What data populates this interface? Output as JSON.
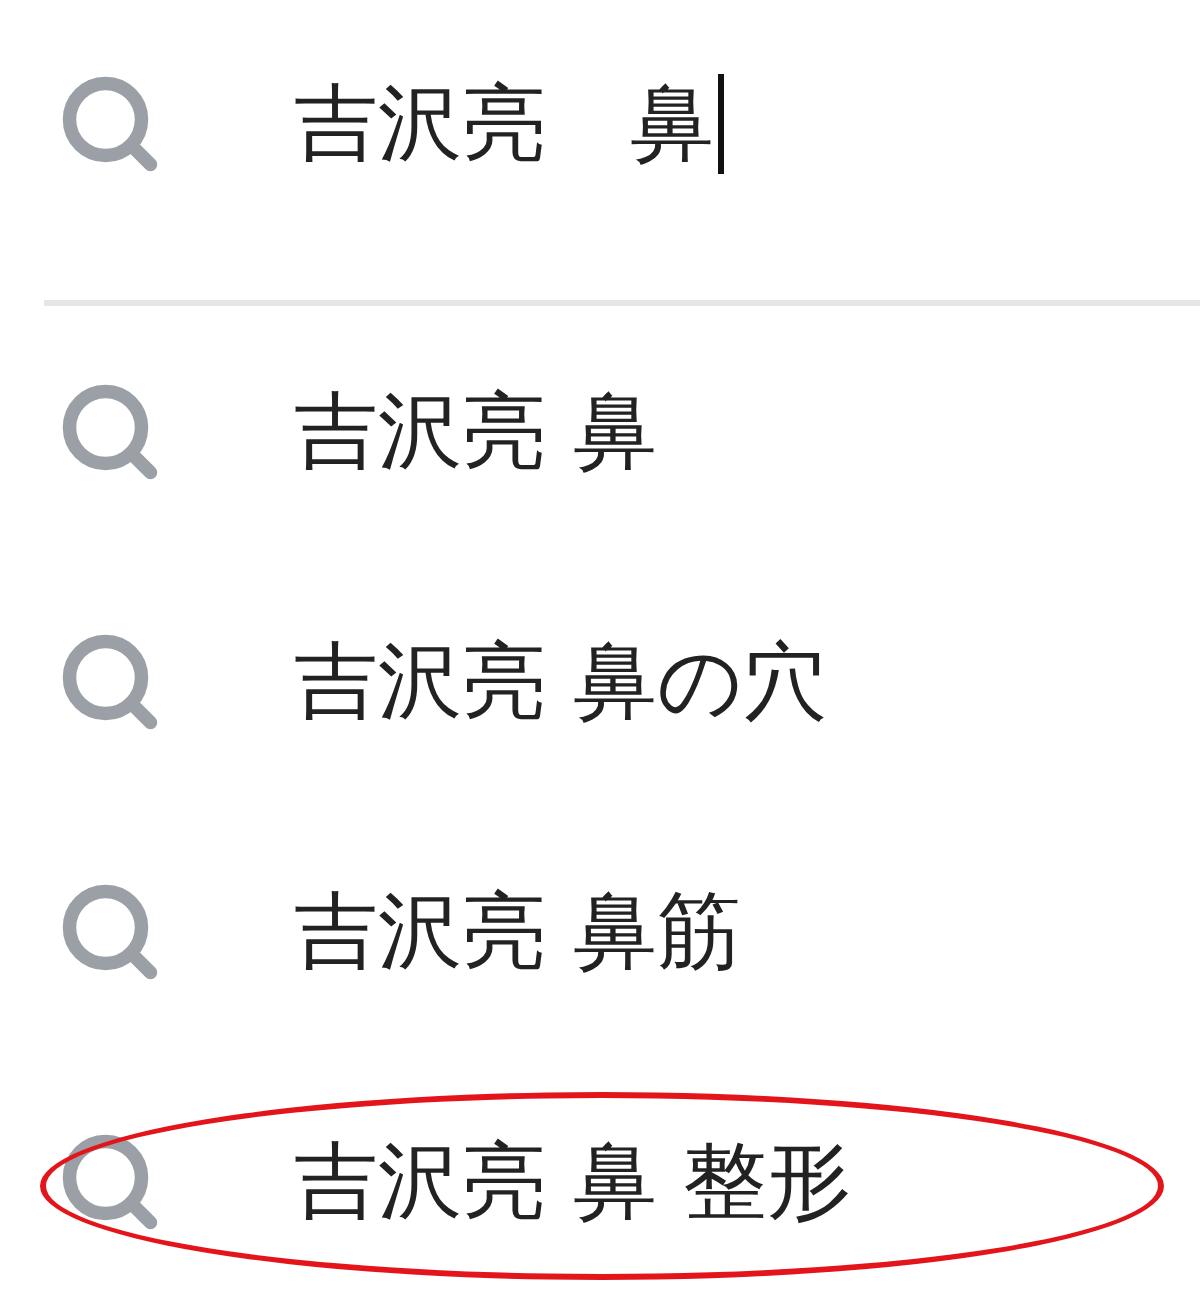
{
  "search": {
    "value": "吉沢亮　鼻"
  },
  "suggestions": [
    {
      "text": "吉沢亮 鼻",
      "highlighted": false
    },
    {
      "text": "吉沢亮 鼻の穴",
      "highlighted": false
    },
    {
      "text": "吉沢亮 鼻筋",
      "highlighted": false
    },
    {
      "text": "吉沢亮 鼻 整形",
      "highlighted": true
    }
  ]
}
